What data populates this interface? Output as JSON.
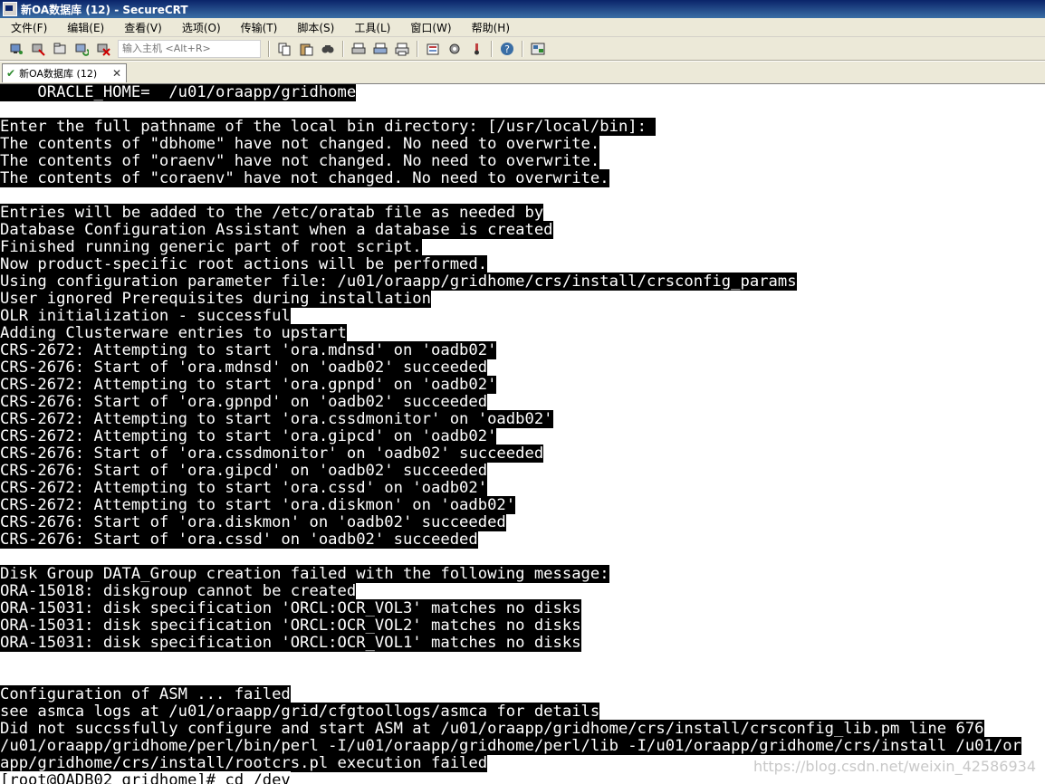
{
  "window": {
    "title": "新OA数据库 (12) - SecureCRT"
  },
  "menu": [
    "文件(F)",
    "编辑(E)",
    "查看(V)",
    "选项(O)",
    "传输(T)",
    "脚本(S)",
    "工具(L)",
    "窗口(W)",
    "帮助(H)"
  ],
  "toolbar": {
    "host_placeholder": "输入主机 <Alt+R>"
  },
  "tab": {
    "label": "新OA数据库 (12)",
    "close": "✕"
  },
  "terminal": {
    "lines": [
      "    ORACLE_HOME=  /u01/oraapp/gridhome",
      "",
      "Enter the full pathname of the local bin directory: [/usr/local/bin]: ",
      "The contents of \"dbhome\" have not changed. No need to overwrite.",
      "The contents of \"oraenv\" have not changed. No need to overwrite.",
      "The contents of \"coraenv\" have not changed. No need to overwrite.",
      "",
      "Entries will be added to the /etc/oratab file as needed by",
      "Database Configuration Assistant when a database is created",
      "Finished running generic part of root script.",
      "Now product-specific root actions will be performed.",
      "Using configuration parameter file: /u01/oraapp/gridhome/crs/install/crsconfig_params",
      "User ignored Prerequisites during installation",
      "OLR initialization - successful",
      "Adding Clusterware entries to upstart",
      "CRS-2672: Attempting to start 'ora.mdnsd' on 'oadb02'",
      "CRS-2676: Start of 'ora.mdnsd' on 'oadb02' succeeded",
      "CRS-2672: Attempting to start 'ora.gpnpd' on 'oadb02'",
      "CRS-2676: Start of 'ora.gpnpd' on 'oadb02' succeeded",
      "CRS-2672: Attempting to start 'ora.cssdmonitor' on 'oadb02'",
      "CRS-2672: Attempting to start 'ora.gipcd' on 'oadb02'",
      "CRS-2676: Start of 'ora.cssdmonitor' on 'oadb02' succeeded",
      "CRS-2676: Start of 'ora.gipcd' on 'oadb02' succeeded",
      "CRS-2672: Attempting to start 'ora.cssd' on 'oadb02'",
      "CRS-2672: Attempting to start 'ora.diskmon' on 'oadb02'",
      "CRS-2676: Start of 'ora.diskmon' on 'oadb02' succeeded",
      "CRS-2676: Start of 'ora.cssd' on 'oadb02' succeeded",
      "",
      "Disk Group DATA_Group creation failed with the following message:",
      "ORA-15018: diskgroup cannot be created",
      "ORA-15031: disk specification 'ORCL:OCR_VOL3' matches no disks",
      "ORA-15031: disk specification 'ORCL:OCR_VOL2' matches no disks",
      "ORA-15031: disk specification 'ORCL:OCR_VOL1' matches no disks",
      "",
      "",
      "Configuration of ASM ... failed",
      "see asmca logs at /u01/oraapp/grid/cfgtoollogs/asmca for details",
      "Did not succssfully configure and start ASM at /u01/oraapp/gridhome/crs/install/crsconfig_lib.pm line 676",
      "/u01/oraapp/gridhome/perl/bin/perl -I/u01/oraapp/gridhome/perl/lib -I/u01/oraapp/gridhome/crs/install /u01/or",
      "app/gridhome/crs/install/rootcrs.pl execution failed",
      "[root@OADB02 gridhome]# cd /dev"
    ]
  },
  "watermark": "https://blog.csdn.net/weixin_42586934"
}
